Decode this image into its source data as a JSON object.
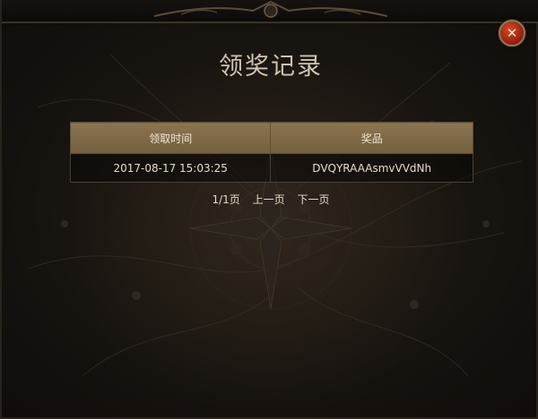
{
  "dialog": {
    "title": "领奖记录",
    "close_icon": "close-icon",
    "colors": {
      "header_bg": "#8a7450",
      "close_red": "#9d2410",
      "text": "#e6dccb"
    }
  },
  "table": {
    "headers": [
      "领取时间",
      "奖品"
    ],
    "rows": [
      {
        "time": "2017-08-17 15:03:25",
        "prize": "DVQYRAAAsmvVVdNh"
      }
    ]
  },
  "pager": {
    "page_info": "1/1页",
    "prev_label": "上一页",
    "next_label": "下一页"
  }
}
